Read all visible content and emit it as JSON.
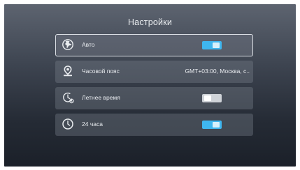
{
  "header": {
    "title": "Настройки"
  },
  "settings": [
    {
      "id": "auto",
      "label": "Авто",
      "icon": "globe-icon",
      "control": "toggle",
      "enabled": true,
      "selected": true
    },
    {
      "id": "timezone",
      "label": "Часовой пояс",
      "icon": "location-pin-icon",
      "control": "value",
      "value": "GMT+03:00, Москва, с..",
      "selected": false
    },
    {
      "id": "dst",
      "label": "Летнее время",
      "icon": "daylight-saving-clock-icon",
      "control": "toggle",
      "enabled": false,
      "selected": false
    },
    {
      "id": "hour24",
      "label": "24 часа",
      "icon": "clock-icon",
      "control": "toggle",
      "enabled": true,
      "selected": false
    }
  ],
  "colors": {
    "toggle_on": "#3fb6ef",
    "toggle_off": "#cfd3d8",
    "selection_border": "#d9dde3"
  }
}
